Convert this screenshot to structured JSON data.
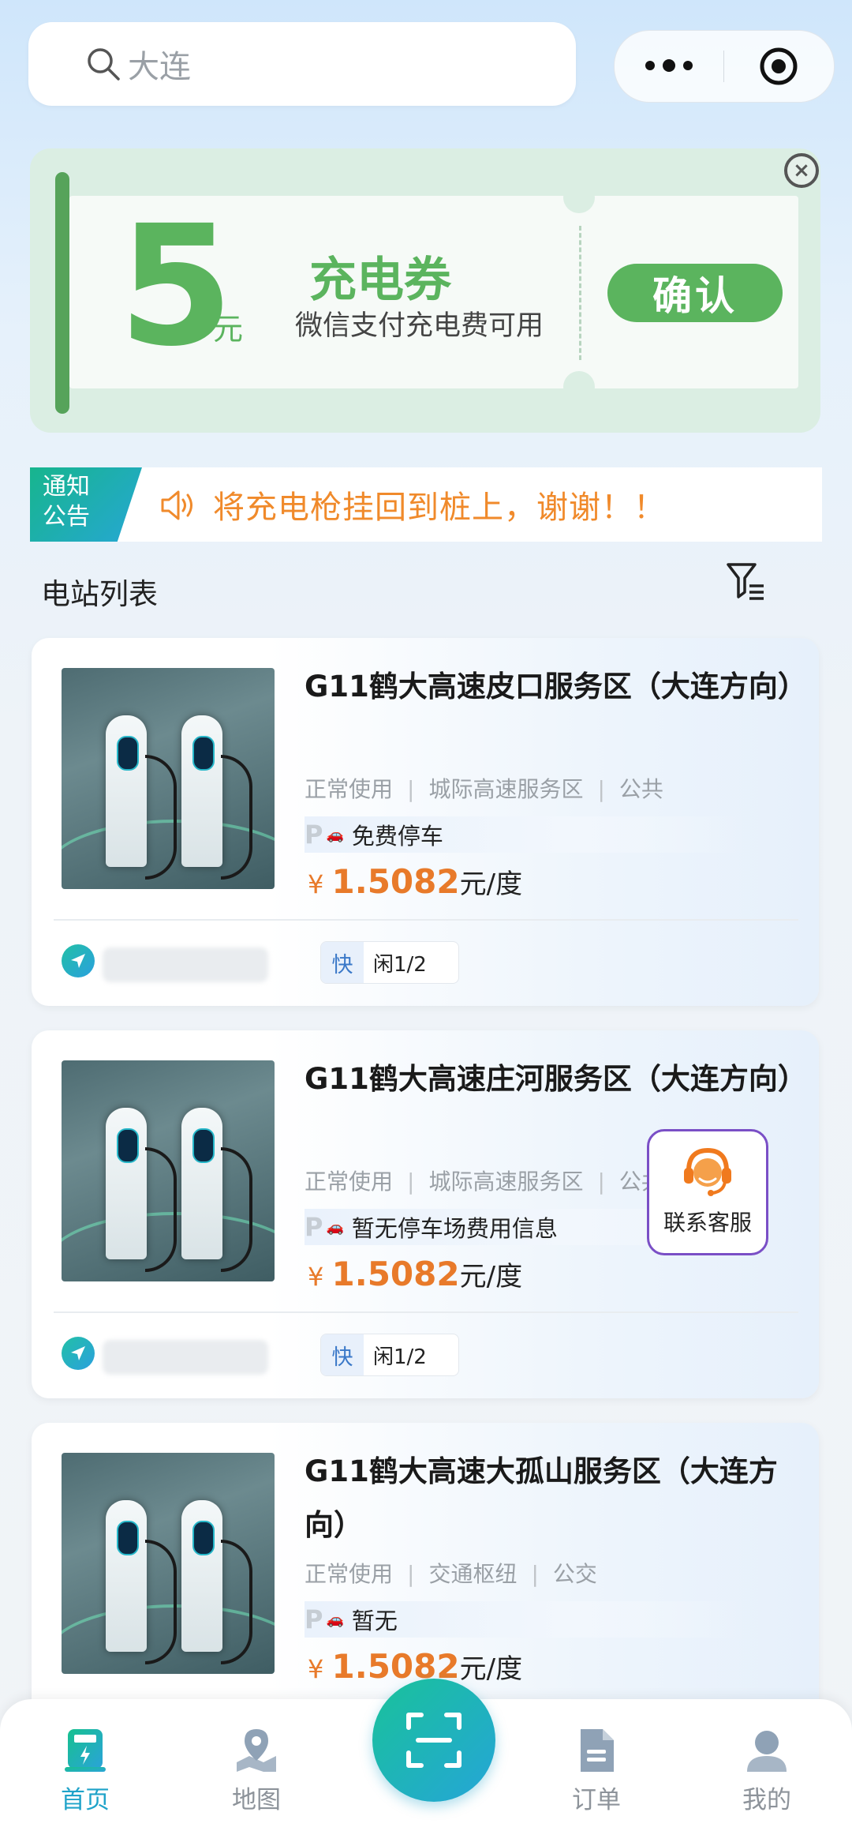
{
  "search": {
    "placeholder": "大连"
  },
  "coupon": {
    "amount": "5",
    "currency": "元",
    "title": "充电券",
    "subtitle": "微信支付充电费可用",
    "confirm_label": "确认",
    "accent_color": "#5bb45e"
  },
  "notice": {
    "tag_line1": "通知",
    "tag_line2": "公告",
    "text": "将充电枪挂回到桩上，谢谢！！",
    "text_color": "#f08a2b"
  },
  "list": {
    "title": "电站列表"
  },
  "stations": [
    {
      "name": "G11鹤大高速皮口服务区（大连方向）",
      "status": "正常使用",
      "category": "城际高速服务区",
      "type": "公共",
      "parking": "免费停车",
      "currency_symbol": "¥",
      "price": "1.5082",
      "price_unit": "元/度",
      "fast_label": "快",
      "idle": "闲1/2"
    },
    {
      "name": "G11鹤大高速庄河服务区（大连方向）",
      "status": "正常使用",
      "category": "城际高速服务区",
      "type": "公共",
      "parking": "暂无停车场费用信息",
      "currency_symbol": "¥",
      "price": "1.5082",
      "price_unit": "元/度",
      "fast_label": "快",
      "idle": "闲1/2"
    },
    {
      "name": "G11鹤大高速大孤山服务区（大连方向）",
      "status": "正常使用",
      "category": "交通枢纽",
      "type": "公交",
      "parking": "暂无",
      "currency_symbol": "¥",
      "price": "1.5082",
      "price_unit": "元/度"
    }
  ],
  "customer_service": {
    "label": "联系客服"
  },
  "tabbar": {
    "home": "首页",
    "map": "地图",
    "orders": "订单",
    "mine": "我的",
    "active_color": "#1fa3c9"
  }
}
